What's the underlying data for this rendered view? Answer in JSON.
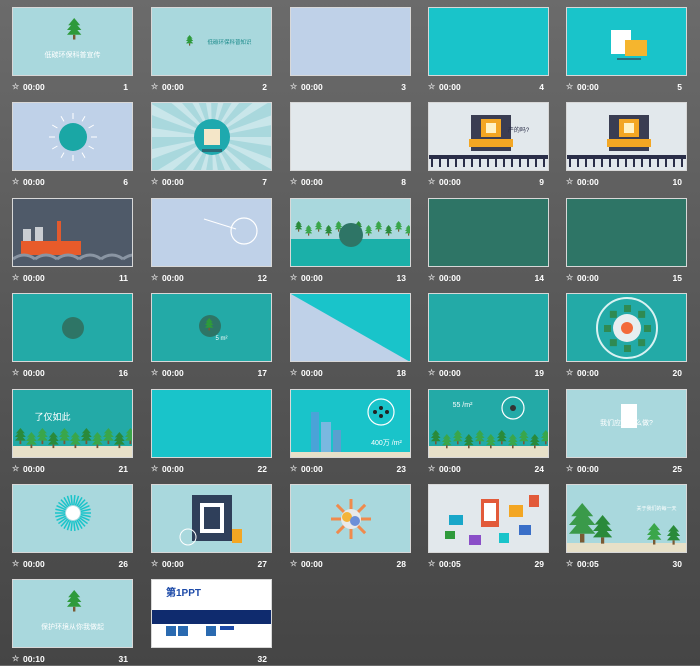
{
  "colors": {
    "light": "#a9d8dd",
    "teal": "#19c4ca",
    "dark": "#2e7566",
    "blue": "#bfd1e8",
    "grey": "#e2e8ec",
    "mid": "#23aaa7",
    "dark_blue": "#4e5866"
  },
  "slides": [
    {
      "num": "1",
      "time": "00:00",
      "bg": "light",
      "art": "tree-title",
      "caption": "低碳环保科普宣传"
    },
    {
      "num": "2",
      "time": "00:00",
      "bg": "light",
      "art": "tree-small",
      "caption": "低碳环保科普知识"
    },
    {
      "num": "3",
      "time": "00:00",
      "bg": "blue",
      "art": "",
      "caption": ""
    },
    {
      "num": "4",
      "time": "00:00",
      "bg": "teal",
      "art": "",
      "caption": ""
    },
    {
      "num": "5",
      "time": "00:00",
      "bg": "teal",
      "art": "folder",
      "caption": ""
    },
    {
      "num": "6",
      "time": "00:00",
      "bg": "blue",
      "art": "sun",
      "caption": ""
    },
    {
      "num": "7",
      "time": "00:00",
      "bg": "light",
      "art": "rays",
      "caption": ""
    },
    {
      "num": "8",
      "time": "00:00",
      "bg": "grey",
      "art": "",
      "caption": ""
    },
    {
      "num": "9",
      "time": "00:00",
      "bg": "grey",
      "art": "station",
      "caption": "产的吗?"
    },
    {
      "num": "10",
      "time": "00:00",
      "bg": "grey",
      "art": "station",
      "caption": ""
    },
    {
      "num": "11",
      "time": "00:00",
      "bg": "dark_blue",
      "art": "factory",
      "caption": ""
    },
    {
      "num": "12",
      "time": "00:00",
      "bg": "blue",
      "art": "circle-outline",
      "caption": ""
    },
    {
      "num": "13",
      "time": "00:00",
      "bg": "light",
      "art": "island",
      "caption": ""
    },
    {
      "num": "14",
      "time": "00:00",
      "bg": "dark",
      "art": "",
      "caption": ""
    },
    {
      "num": "15",
      "time": "00:00",
      "bg": "dark",
      "art": "",
      "caption": ""
    },
    {
      "num": "16",
      "time": "00:00",
      "bg": "mid",
      "art": "dot",
      "caption": ""
    },
    {
      "num": "17",
      "time": "00:00",
      "bg": "mid",
      "art": "tree-circle",
      "caption": "5 m²"
    },
    {
      "num": "18",
      "time": "00:00",
      "bg": "blue",
      "art": "diagonal",
      "caption": ""
    },
    {
      "num": "19",
      "time": "00:00",
      "bg": "mid",
      "art": "",
      "caption": ""
    },
    {
      "num": "20",
      "time": "00:00",
      "bg": "mid",
      "art": "gear",
      "caption": ""
    },
    {
      "num": "21",
      "time": "00:00",
      "bg": "mid",
      "art": "forest",
      "caption": "了仅如此"
    },
    {
      "num": "22",
      "time": "00:00",
      "bg": "teal",
      "art": "",
      "caption": ""
    },
    {
      "num": "23",
      "time": "00:00",
      "bg": "teal",
      "art": "city",
      "caption": "400万 /m²"
    },
    {
      "num": "24",
      "time": "00:00",
      "bg": "mid",
      "art": "forest-circle",
      "caption": "55 /m²"
    },
    {
      "num": "25",
      "time": "00:00",
      "bg": "light",
      "art": "question",
      "caption": "我们应该怎么做?"
    },
    {
      "num": "26",
      "time": "00:00",
      "bg": "light",
      "art": "burst",
      "caption": ""
    },
    {
      "num": "27",
      "time": "00:00",
      "bg": "light",
      "art": "frame",
      "caption": ""
    },
    {
      "num": "28",
      "time": "00:00",
      "bg": "light",
      "art": "gear-small",
      "caption": ""
    },
    {
      "num": "29",
      "time": "00:05",
      "bg": "grey",
      "art": "infographic",
      "caption": ""
    },
    {
      "num": "30",
      "time": "00:05",
      "bg": "light",
      "art": "pines",
      "caption": "关于我们的每一天"
    },
    {
      "num": "31",
      "time": "00:10",
      "bg": "light",
      "art": "tree-title",
      "caption": "保护环境从你我做起"
    },
    {
      "num": "32",
      "time": "",
      "bg": "white",
      "art": "ppt",
      "caption": "第1PPT"
    }
  ]
}
